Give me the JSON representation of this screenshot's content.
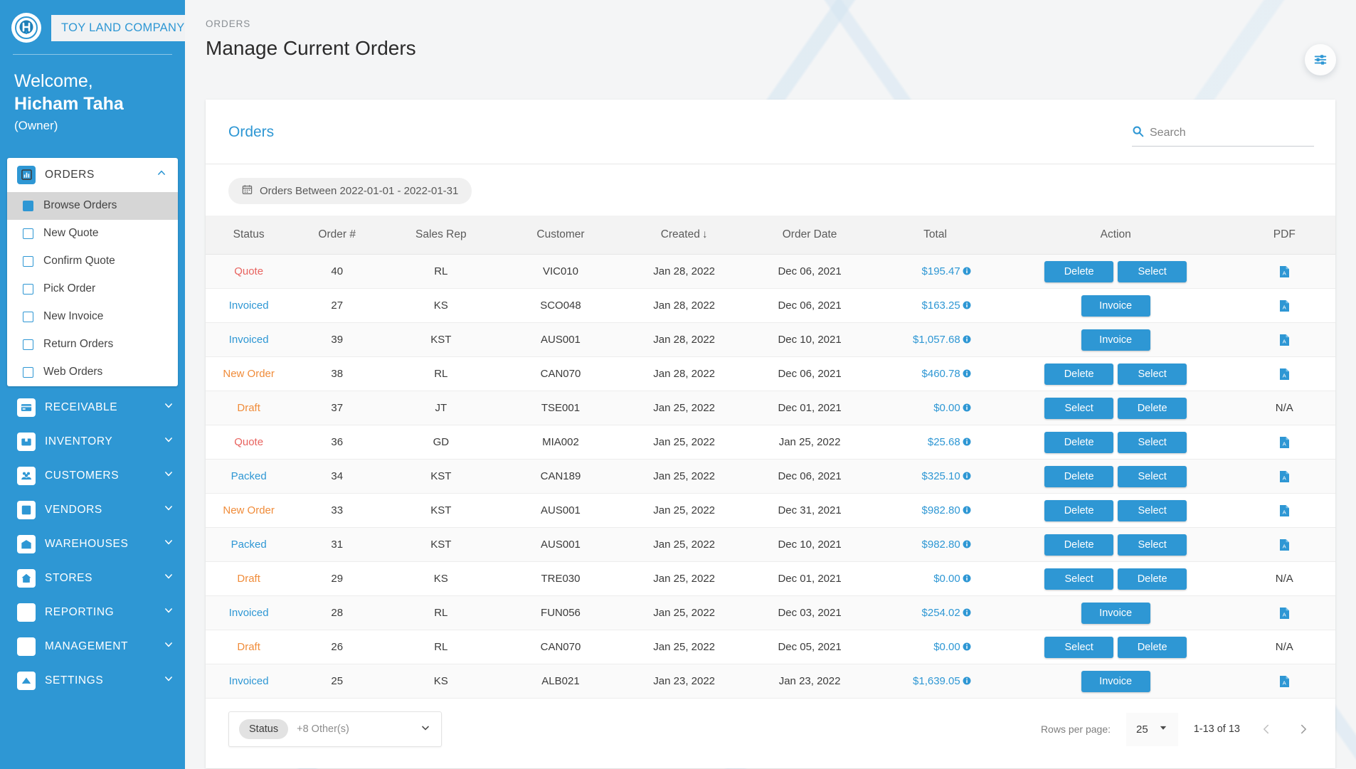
{
  "sidebar": {
    "logo_icon": "circle-h-logo-icon",
    "brand": "TOY LAND COMPANY",
    "welcome_line": "Welcome,",
    "user_name": "Hicham Taha",
    "user_role": "(Owner)",
    "groups": [
      {
        "label": "ORDERS",
        "icon": "chart-bar-icon",
        "expanded": true,
        "items": [
          {
            "label": "Browse Orders",
            "active": true
          },
          {
            "label": "New Quote",
            "active": false
          },
          {
            "label": "Confirm Quote",
            "active": false
          },
          {
            "label": "Pick Order",
            "active": false
          },
          {
            "label": "New Invoice",
            "active": false
          },
          {
            "label": "Return Orders",
            "active": false
          },
          {
            "label": "Web Orders",
            "active": false
          }
        ]
      },
      {
        "label": "RECEIVABLE",
        "icon": "credit-card-icon",
        "expanded": false,
        "items": []
      },
      {
        "label": "INVENTORY",
        "icon": "box-icon",
        "expanded": false,
        "items": []
      },
      {
        "label": "CUSTOMERS",
        "icon": "people-icon",
        "expanded": false,
        "items": []
      },
      {
        "label": "VENDORS",
        "icon": "contact-card-icon",
        "expanded": false,
        "items": []
      },
      {
        "label": "WAREHOUSES",
        "icon": "warehouse-icon",
        "expanded": false,
        "items": []
      },
      {
        "label": "STORES",
        "icon": "home-icon",
        "expanded": false,
        "items": []
      },
      {
        "label": "REPORTING",
        "icon": "line-chart-icon",
        "expanded": false,
        "items": []
      },
      {
        "label": "MANAGEMENT",
        "icon": "key-icon",
        "expanded": false,
        "items": []
      },
      {
        "label": "SETTINGS",
        "icon": "gear-icon",
        "expanded": false,
        "items": []
      }
    ]
  },
  "header": {
    "breadcrumb": "ORDERS",
    "title": "Manage Current Orders",
    "fab_icon": "sliders-filter-icon"
  },
  "card": {
    "title": "Orders",
    "search_placeholder": "Search",
    "search_value": "",
    "search_icon": "search-icon",
    "date_chip": "Orders Between 2022-01-01 - 2022-01-31",
    "date_chip_icon": "calendar-icon"
  },
  "table": {
    "columns": [
      "Status",
      "Order #",
      "Sales Rep",
      "Customer",
      "Created",
      "Order Date",
      "Total",
      "Action",
      "PDF"
    ],
    "sorted_column": "Created",
    "sort_direction": "↓",
    "rows": [
      {
        "status": "Quote",
        "status_color": "#e8635f",
        "order": "40",
        "rep": "RL",
        "customer": "VIC010",
        "created": "Jan 28, 2022",
        "order_date": "Dec 06, 2021",
        "total": "$195.47",
        "actions": [
          "Delete",
          "Select"
        ],
        "pdf": "pdf"
      },
      {
        "status": "Invoiced",
        "status_color": "#2e97d4",
        "order": "27",
        "rep": "KS",
        "customer": "SCO048",
        "created": "Jan 28, 2022",
        "order_date": "Dec 06, 2021",
        "total": "$163.25",
        "actions": [
          "Invoice"
        ],
        "pdf": "pdf"
      },
      {
        "status": "Invoiced",
        "status_color": "#2e97d4",
        "order": "39",
        "rep": "KST",
        "customer": "AUS001",
        "created": "Jan 28, 2022",
        "order_date": "Dec 10, 2021",
        "total": "$1,057.68",
        "actions": [
          "Invoice"
        ],
        "pdf": "pdf"
      },
      {
        "status": "New Order",
        "status_color": "#f08c3a",
        "order": "38",
        "rep": "RL",
        "customer": "CAN070",
        "created": "Jan 28, 2022",
        "order_date": "Dec 06, 2021",
        "total": "$460.78",
        "actions": [
          "Delete",
          "Select"
        ],
        "pdf": "pdf"
      },
      {
        "status": "Draft",
        "status_color": "#f08c3a",
        "order": "37",
        "rep": "JT",
        "customer": "TSE001",
        "created": "Jan 25, 2022",
        "order_date": "Dec 01, 2021",
        "total": "$0.00",
        "actions": [
          "Select",
          "Delete"
        ],
        "pdf": "N/A"
      },
      {
        "status": "Quote",
        "status_color": "#e8635f",
        "order": "36",
        "rep": "GD",
        "customer": "MIA002",
        "created": "Jan 25, 2022",
        "order_date": "Jan 25, 2022",
        "total": "$25.68",
        "actions": [
          "Delete",
          "Select"
        ],
        "pdf": "pdf"
      },
      {
        "status": "Packed",
        "status_color": "#2e97d4",
        "order": "34",
        "rep": "KST",
        "customer": "CAN189",
        "created": "Jan 25, 2022",
        "order_date": "Dec 06, 2021",
        "total": "$325.10",
        "actions": [
          "Delete",
          "Select"
        ],
        "pdf": "pdf"
      },
      {
        "status": "New Order",
        "status_color": "#f08c3a",
        "order": "33",
        "rep": "KST",
        "customer": "AUS001",
        "created": "Jan 25, 2022",
        "order_date": "Dec 31, 2021",
        "total": "$982.80",
        "actions": [
          "Delete",
          "Select"
        ],
        "pdf": "pdf"
      },
      {
        "status": "Packed",
        "status_color": "#2e97d4",
        "order": "31",
        "rep": "KST",
        "customer": "AUS001",
        "created": "Jan 25, 2022",
        "order_date": "Dec 10, 2021",
        "total": "$982.80",
        "actions": [
          "Delete",
          "Select"
        ],
        "pdf": "pdf"
      },
      {
        "status": "Draft",
        "status_color": "#f08c3a",
        "order": "29",
        "rep": "KS",
        "customer": "TRE030",
        "created": "Jan 25, 2022",
        "order_date": "Dec 01, 2021",
        "total": "$0.00",
        "actions": [
          "Select",
          "Delete"
        ],
        "pdf": "N/A"
      },
      {
        "status": "Invoiced",
        "status_color": "#2e97d4",
        "order": "28",
        "rep": "RL",
        "customer": "FUN056",
        "created": "Jan 25, 2022",
        "order_date": "Dec 03, 2021",
        "total": "$254.02",
        "actions": [
          "Invoice"
        ],
        "pdf": "pdf"
      },
      {
        "status": "Draft",
        "status_color": "#f08c3a",
        "order": "26",
        "rep": "RL",
        "customer": "CAN070",
        "created": "Jan 25, 2022",
        "order_date": "Dec 05, 2021",
        "total": "$0.00",
        "actions": [
          "Select",
          "Delete"
        ],
        "pdf": "N/A"
      },
      {
        "status": "Invoiced",
        "status_color": "#2e97d4",
        "order": "25",
        "rep": "KS",
        "customer": "ALB021",
        "created": "Jan 23, 2022",
        "order_date": "Jan 23, 2022",
        "total": "$1,639.05",
        "actions": [
          "Invoice"
        ],
        "pdf": "pdf"
      }
    ]
  },
  "footer": {
    "status_filter_pill": "Status",
    "status_filter_other": "+8 Other(s)",
    "rows_per_page_label": "Rows per page:",
    "rows_per_page_value": "25",
    "range": "1-13 of 13",
    "prev_icon": "chevron-left-icon",
    "next_icon": "chevron-right-icon"
  },
  "colors": {
    "brand_blue": "#2e97d4",
    "status_quote": "#e8635f",
    "status_invoiced": "#2e97d4",
    "status_new_order": "#f08c3a",
    "status_draft": "#f08c3a",
    "status_packed": "#2e97d4"
  }
}
